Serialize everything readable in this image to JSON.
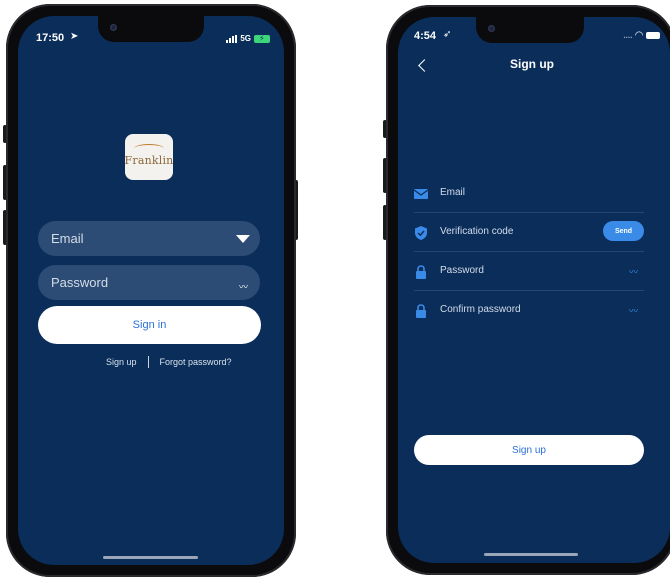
{
  "left_phone": {
    "status_time": "17:50",
    "signal_label": "5G",
    "logo_text": "Franklin",
    "email_placeholder": "Email",
    "password_placeholder": "Password",
    "signin_label": "Sign in",
    "signup_link": "Sign up",
    "forgot_link": "Forgot password?"
  },
  "right_phone": {
    "status_time": "4:54",
    "status_dots": "....",
    "title": "Sign up",
    "fields": [
      {
        "label": "Email",
        "icon": "mail-icon"
      },
      {
        "label": "Verification code",
        "icon": "shield-icon",
        "action": "Send"
      },
      {
        "label": "Password",
        "icon": "lock-icon"
      },
      {
        "label": "Confirm password",
        "icon": "lock-icon"
      }
    ],
    "signup_label": "Sign up"
  },
  "colors": {
    "screen_bg": "#0a2d5a",
    "input_bg": "#2c4c75",
    "accent": "#3a8be8",
    "button_text": "#2a6fd6"
  }
}
